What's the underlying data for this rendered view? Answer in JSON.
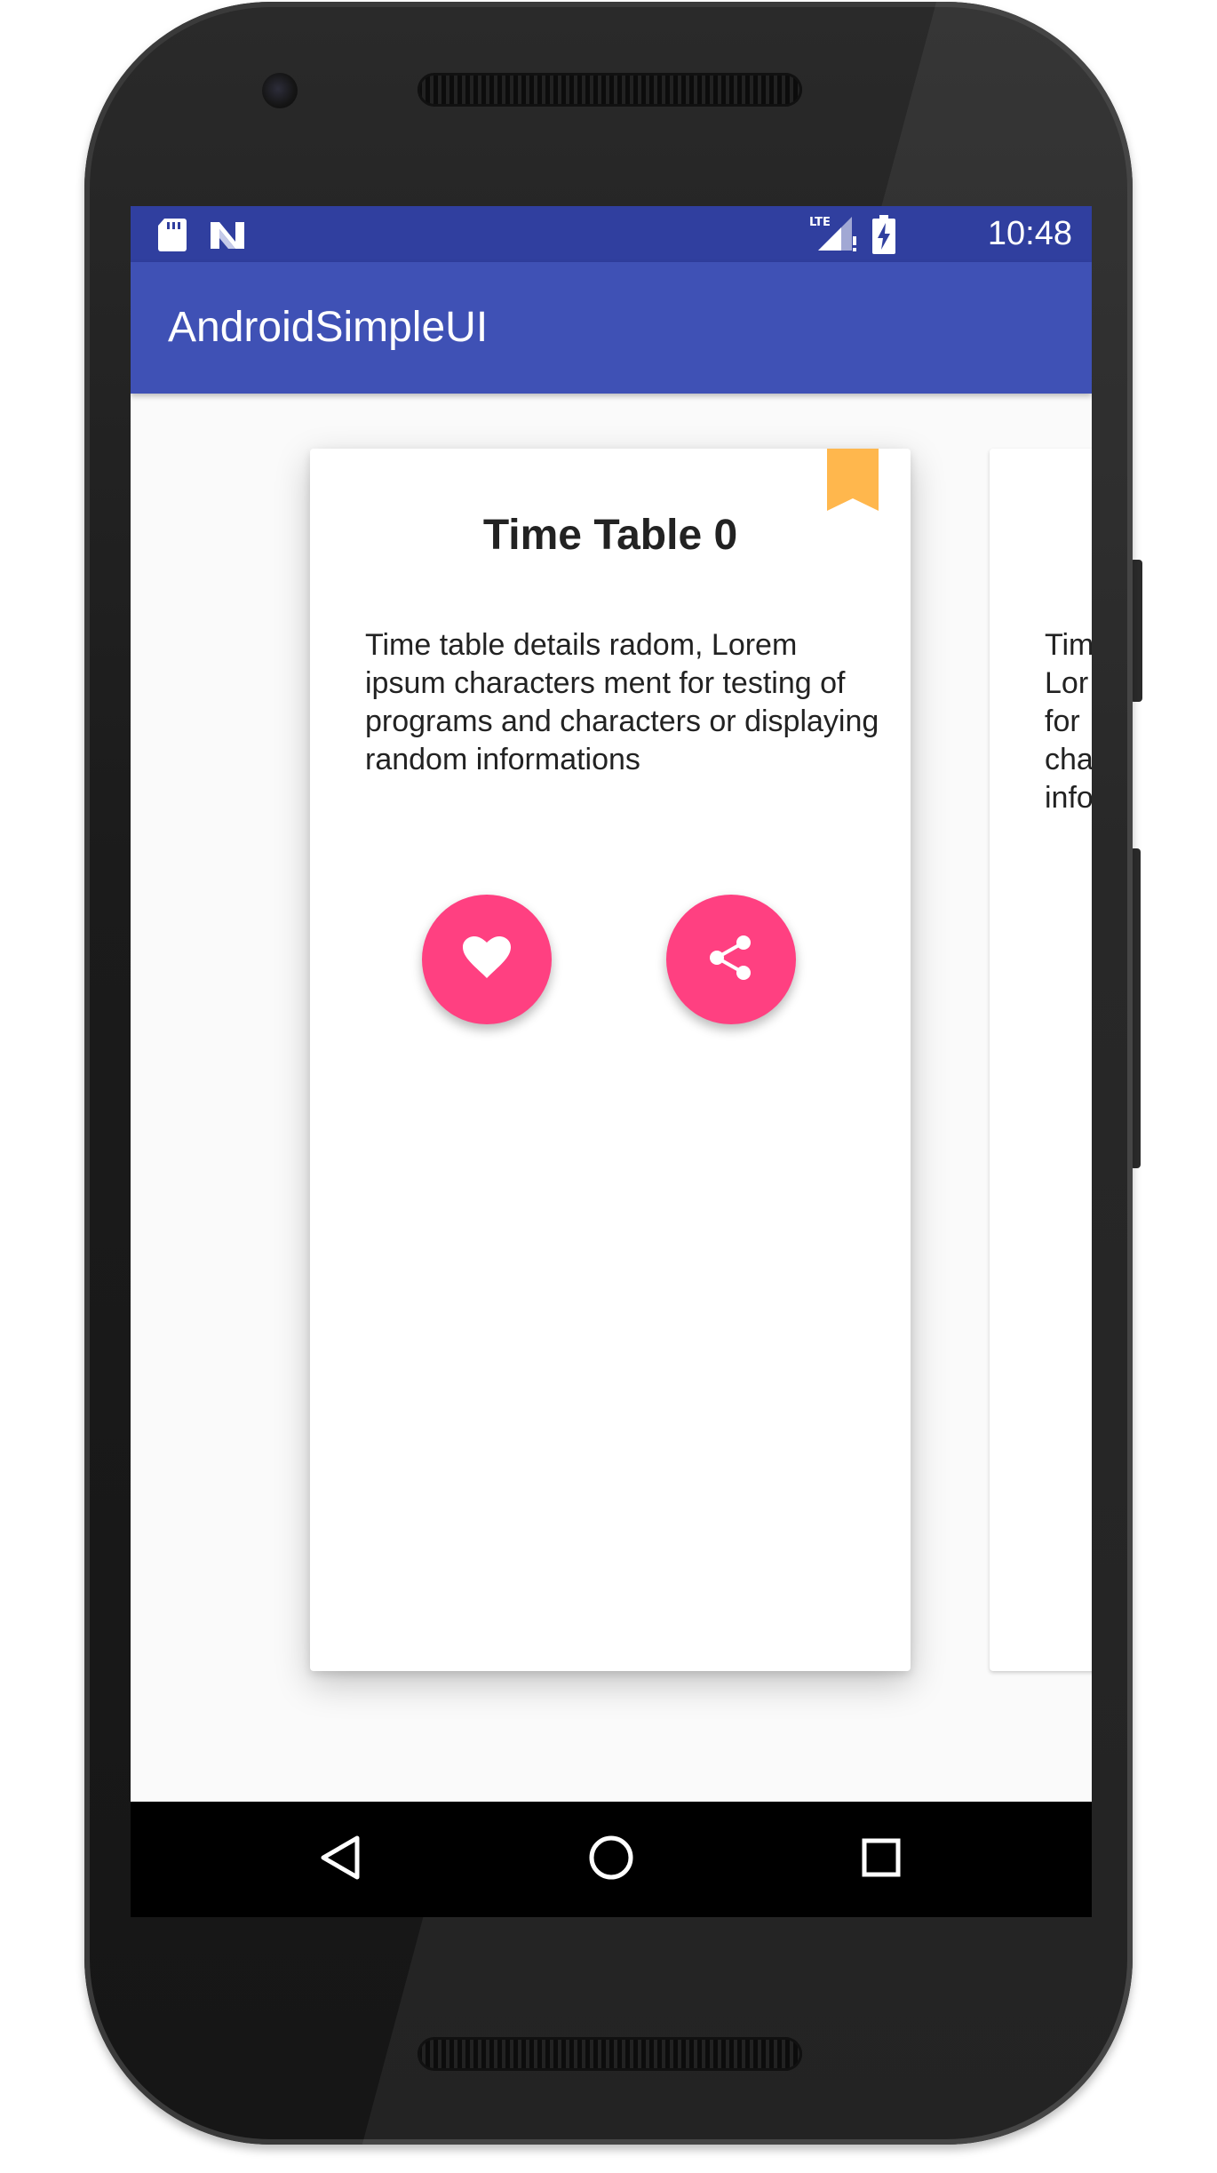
{
  "status_bar": {
    "time": "10:48",
    "icons": [
      "sd-card-icon",
      "n-logo-icon",
      "lte-signal-icon",
      "battery-charging-icon"
    ],
    "lte_label": "LTE",
    "background": "#303f9f"
  },
  "app_bar": {
    "title": "AndroidSimpleUI",
    "background": "#3f51b5"
  },
  "cards": [
    {
      "title": "Time Table 0",
      "body": "Time table details radom, Lorem ipsum characters ment for testing of programs and characters or displaying random informations",
      "bookmark_icon": "bookmark-icon",
      "actions": [
        {
          "icon": "heart-icon",
          "name": "like-button"
        },
        {
          "icon": "share-icon",
          "name": "share-button"
        }
      ]
    },
    {
      "body_lines": [
        "Tim",
        "Lor",
        "for",
        "cha",
        "info"
      ]
    }
  ],
  "colors": {
    "accent": "#ff4081",
    "bookmark": "#ffb74d",
    "card_background": "#ffffff",
    "screen_background": "#fafafa"
  },
  "nav_bar": {
    "buttons": [
      "back-icon",
      "home-icon",
      "recents-icon"
    ]
  }
}
